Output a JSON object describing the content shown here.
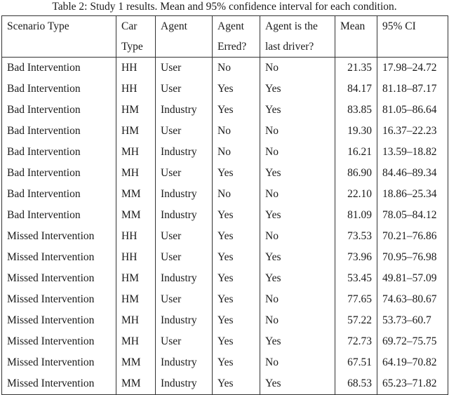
{
  "caption": "Table 2: Study 1 results. Mean and 95% confidence interval for each condition.",
  "headers": [
    {
      "line1": "Scenario Type",
      "line2": ""
    },
    {
      "line1": "Car",
      "line2": "Type"
    },
    {
      "line1": "Agent",
      "line2": ""
    },
    {
      "line1": "Agent",
      "line2": "Erred?"
    },
    {
      "line1": "Agent is the",
      "line2": "last driver?"
    },
    {
      "line1": "Mean",
      "line2": ""
    },
    {
      "line1": "95% CI",
      "line2": ""
    }
  ],
  "rows": [
    [
      "Bad Intervention",
      "HH",
      "User",
      "No",
      "No",
      "21.35",
      "17.98–24.72"
    ],
    [
      "Bad Intervention",
      "HH",
      "User",
      "Yes",
      "Yes",
      "84.17",
      "81.18–87.17"
    ],
    [
      "Bad Intervention",
      "HM",
      "Industry",
      "Yes",
      "Yes",
      "83.85",
      "81.05–86.64"
    ],
    [
      "Bad Intervention",
      "HM",
      "User",
      "No",
      "No",
      "19.30",
      "16.37–22.23"
    ],
    [
      "Bad Intervention",
      "MH",
      "Industry",
      "No",
      "No",
      "16.21",
      "13.59–18.82"
    ],
    [
      "Bad Intervention",
      "MH",
      "User",
      "Yes",
      "Yes",
      "86.90",
      "84.46–89.34"
    ],
    [
      "Bad Intervention",
      "MM",
      "Industry",
      "No",
      "No",
      "22.10",
      "18.86–25.34"
    ],
    [
      "Bad Intervention",
      "MM",
      "Industry",
      "Yes",
      "Yes",
      "81.09",
      "78.05–84.12"
    ],
    [
      "Missed Intervention",
      "HH",
      "User",
      "Yes",
      "No",
      "73.53",
      "70.21–76.86"
    ],
    [
      "Missed Intervention",
      "HH",
      "User",
      "Yes",
      "Yes",
      "73.96",
      "70.95–76.98"
    ],
    [
      "Missed Intervention",
      "HM",
      "Industry",
      "Yes",
      "Yes",
      "53.45",
      "49.81–57.09"
    ],
    [
      "Missed Intervention",
      "HM",
      "User",
      "Yes",
      "No",
      "77.65",
      "74.63–80.67"
    ],
    [
      "Missed Intervention",
      "MH",
      "Industry",
      "Yes",
      "No",
      "57.22",
      "53.73–60.7"
    ],
    [
      "Missed Intervention",
      "MH",
      "User",
      "Yes",
      "Yes",
      "72.73",
      "69.72–75.75"
    ],
    [
      "Missed Intervention",
      "MM",
      "Industry",
      "Yes",
      "No",
      "67.51",
      "64.19–70.82"
    ],
    [
      "Missed Intervention",
      "MM",
      "Industry",
      "Yes",
      "Yes",
      "68.53",
      "65.23–71.82"
    ]
  ]
}
